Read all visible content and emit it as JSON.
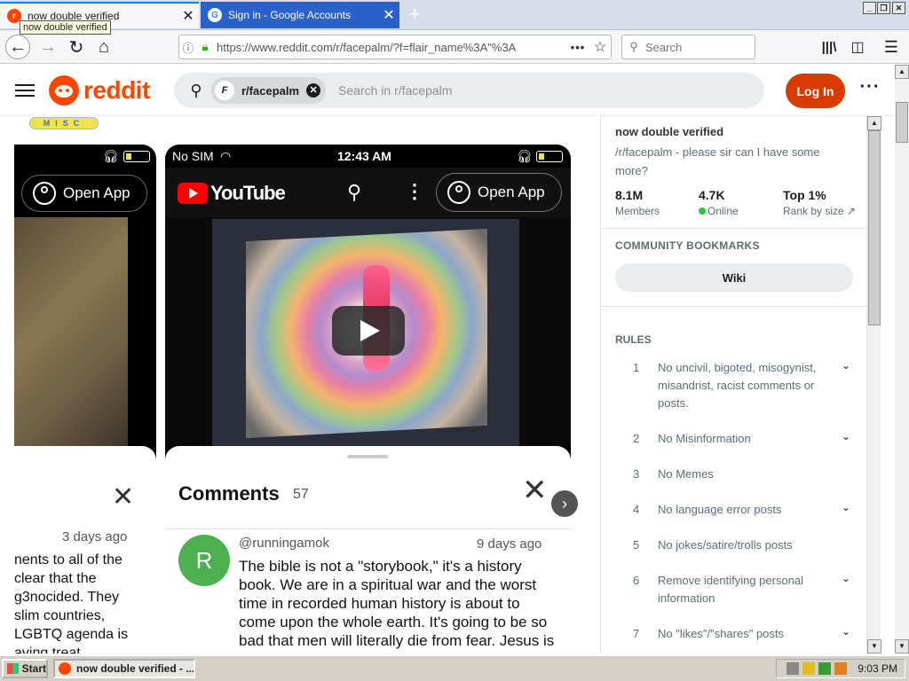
{
  "browser": {
    "tabs": [
      {
        "label": "now double verified",
        "active": true
      },
      {
        "label": "Sign in - Google Accounts",
        "active": false
      }
    ],
    "tooltip": "now double verified",
    "url": "https://www.reddit.com/r/facepalm/?f=flair_name%3A\"%3A",
    "search_placeholder": "Search"
  },
  "reddit": {
    "logo_text": "reddit",
    "search_chip": "r/facepalm",
    "search_placeholder": "Search in r/facepalm",
    "login_label": "Log In",
    "flair": "MISC"
  },
  "post": {
    "phone_left": {
      "open_app": "Open App",
      "date": "3 days ago",
      "lines": [
        "nents to all of the",
        "clear that the",
        "g3nocided. They",
        "slim countries,",
        "LGBTQ agenda is",
        "aving treat"
      ]
    },
    "phone_main": {
      "carrier": "No SIM",
      "time": "12:43 AM",
      "yt_logo": "YouTube",
      "open_app": "Open App",
      "comments_title": "Comments",
      "comments_count": "57",
      "comment": {
        "avatar_letter": "R",
        "user": "@runningamok",
        "date": "9 days ago",
        "body": "The bible is not a \"storybook,\" it's a history book. We are in a spiritual war and the worst time in recorded human history is about to come upon the whole earth. It's going to be so bad that men will literally die from fear. Jesus is the ONLY WAY. All other religions lie."
      }
    }
  },
  "sidebar": {
    "title": "now double verified",
    "description": "/r/facepalm - please sir can I have some more?",
    "stats": [
      {
        "value": "8.1M",
        "label": "Members"
      },
      {
        "value": "4.7K",
        "label": "Online"
      },
      {
        "value": "Top 1%",
        "label": "Rank by size"
      }
    ],
    "bookmarks_title": "COMMUNITY BOOKMARKS",
    "wiki_label": "Wiki",
    "rules_title": "RULES",
    "rules": [
      {
        "num": "1",
        "text": "No uncivil, bigoted, misogynist, misandrist, racist comments or posts.",
        "expandable": true
      },
      {
        "num": "2",
        "text": "No Misinformation",
        "expandable": true
      },
      {
        "num": "3",
        "text": "No Memes",
        "expandable": false
      },
      {
        "num": "4",
        "text": "No language error posts",
        "expandable": true
      },
      {
        "num": "5",
        "text": "No jokes/satire/trolls posts",
        "expandable": false
      },
      {
        "num": "6",
        "text": "Remove identifying personal information",
        "expandable": true
      },
      {
        "num": "7",
        "text": "No \"likes\"/\"shares\" posts",
        "expandable": true
      }
    ]
  },
  "taskbar": {
    "start_label": "Start",
    "task_label": "now double verified - ...",
    "clock": "9:03 PM"
  },
  "colors": {
    "reddit_orange": "#ff4500",
    "login_button": "#d93a00",
    "online_dot": "#2fc240",
    "inactive_tab": "#2a62c9"
  }
}
